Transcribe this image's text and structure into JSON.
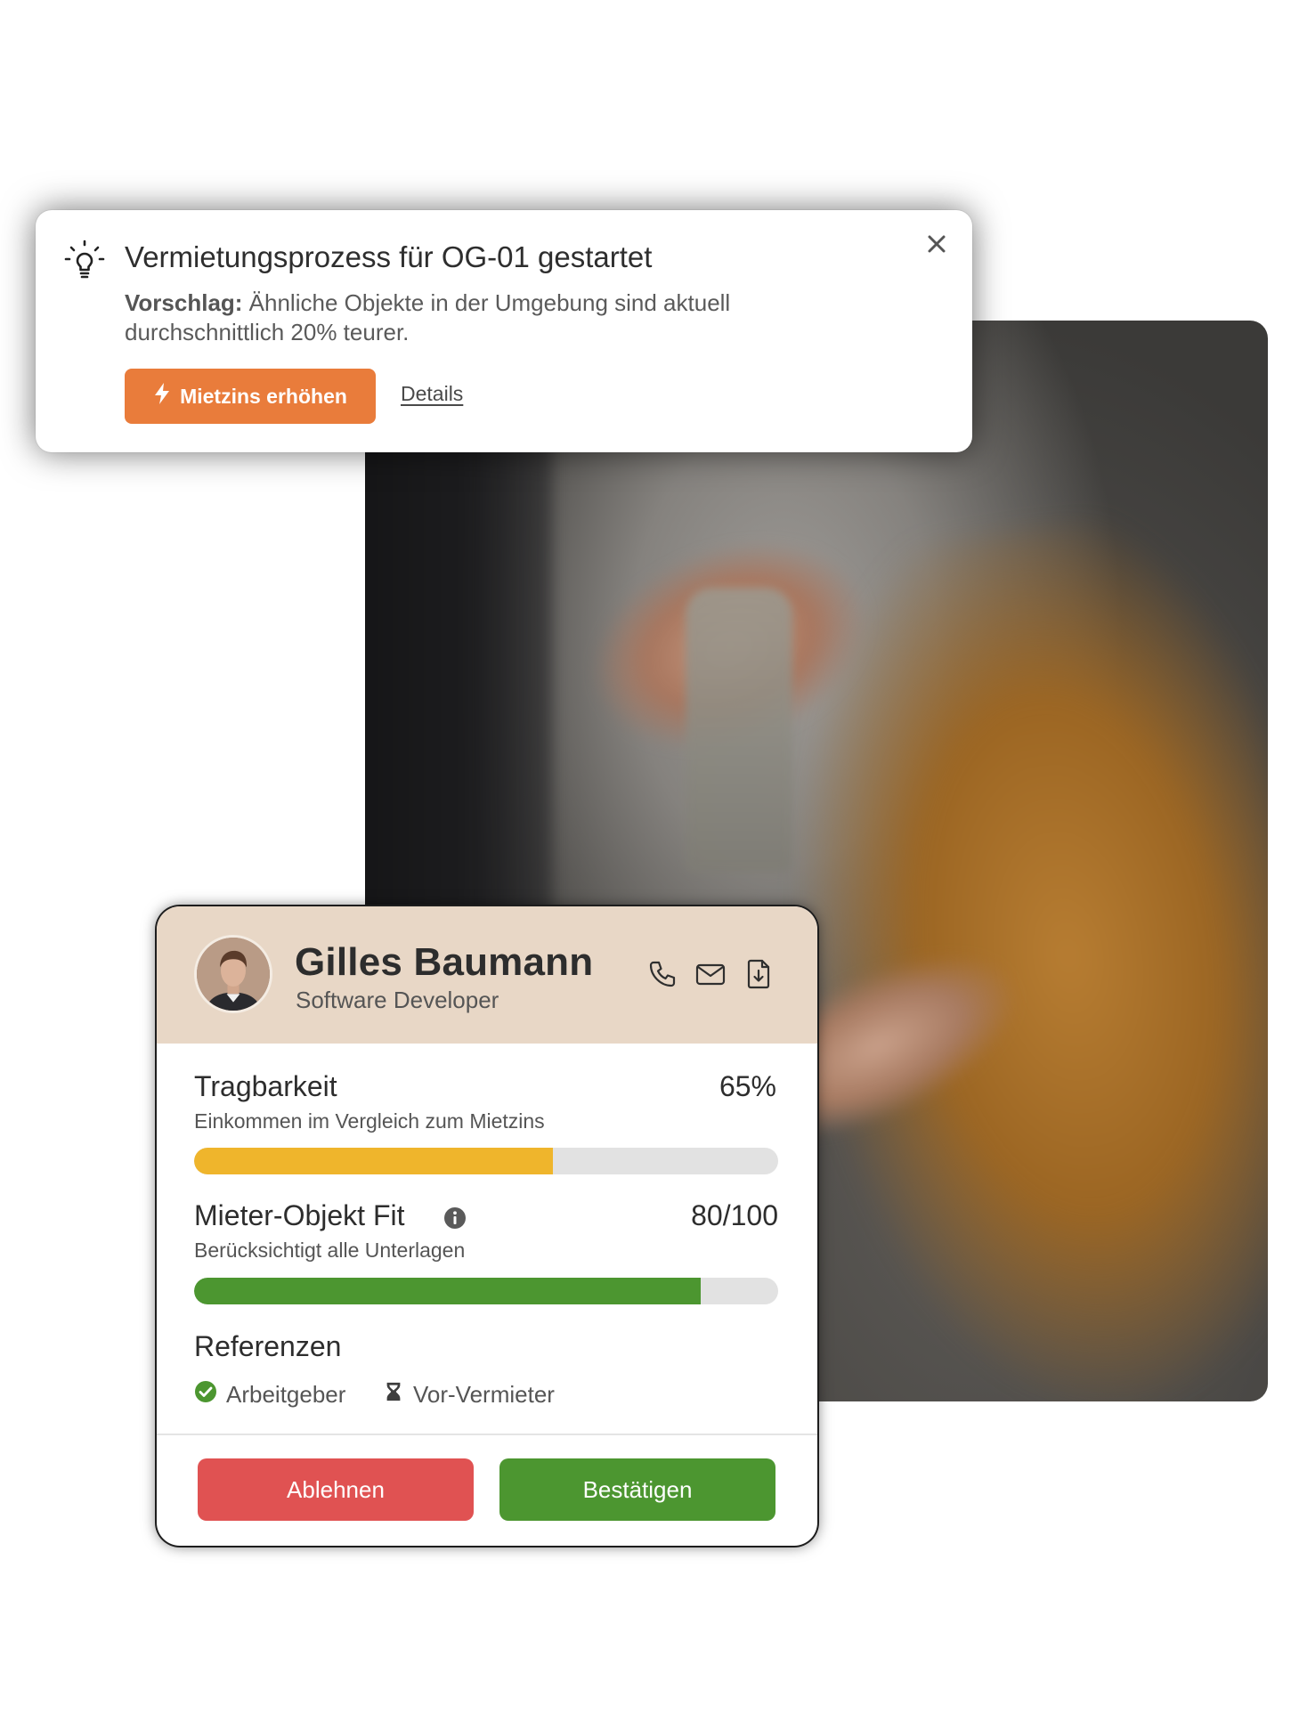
{
  "notification": {
    "title": "Vermietungsprozess für OG-01 gestartet",
    "suggestion_label": "Vorschlag:",
    "suggestion_text": "Ähnliche Objekte in der Umgebung sind aktuell durchschnittlich 20% teurer.",
    "primary_button": "Mietzins erhöhen",
    "details_link": "Details",
    "icons": {
      "leading": "lightbulb-icon",
      "primary_button": "lightning-icon",
      "close": "close-icon"
    }
  },
  "tenant": {
    "name": "Gilles Baumann",
    "role": "Software Developer",
    "actions": [
      {
        "icon": "phone-icon"
      },
      {
        "icon": "mail-icon"
      },
      {
        "icon": "document-download-icon"
      }
    ],
    "metrics": [
      {
        "title": "Tragbarkeit",
        "subtitle": "Einkommen im Vergleich zum Mietzins",
        "value_label": "65%",
        "progress": 0.615,
        "color": "#EFB52C"
      },
      {
        "title": "Mieter-Objekt Fit",
        "subtitle": "Berücksichtigt alle Unterlagen",
        "value_label": "80/100",
        "progress": 0.868,
        "color": "#4C9630",
        "info_icon": "info-icon"
      }
    ],
    "references": {
      "title": "Referenzen",
      "items": [
        {
          "label": "Arbeitgeber",
          "status": "confirmed",
          "icon": "check-circle-icon"
        },
        {
          "label": "Vor-Vermieter",
          "status": "pending",
          "icon": "hourglass-icon"
        }
      ]
    },
    "buttons": {
      "reject": {
        "label": "Ablehnen",
        "color": "#E05252"
      },
      "confirm": {
        "label": "Bestätigen",
        "color": "#4C9630"
      }
    }
  },
  "colors": {
    "accent_orange": "#E97C3B",
    "tenant_header_bg": "#E8D7C6"
  }
}
